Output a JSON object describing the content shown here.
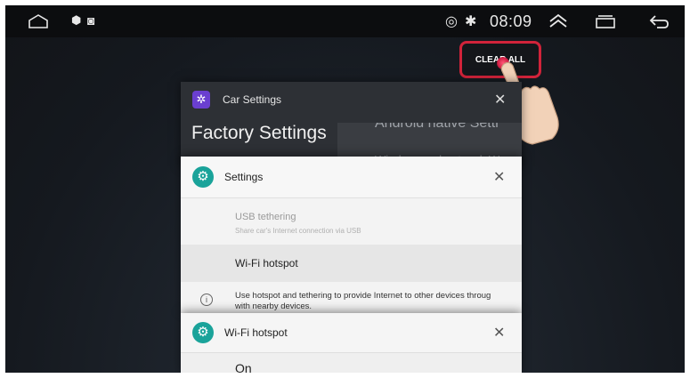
{
  "status_bar": {
    "time": "08:09",
    "icons": [
      "home-icon",
      "location-icon",
      "screenshot-icon",
      "hotspot-icon",
      "bluetooth-icon",
      "expand-up-icon",
      "recent-apps-icon",
      "back-icon"
    ]
  },
  "recents": {
    "clear_all_label": "CLEAR ALL"
  },
  "cards": [
    {
      "app_title": "Car Settings",
      "heading": "Factory Settings",
      "preview_line1": "Android native Setti",
      "preview_line2": "Wireless and network:W"
    },
    {
      "app_title": "Settings",
      "usb_title": "USB tethering",
      "usb_subtitle": "Share car's Internet connection via USB",
      "hotspot_label": "Wi-Fi hotspot",
      "info_text_line1": "Use hotspot and tethering to provide Internet to other devices throug",
      "info_text_line2": "with nearby devices."
    },
    {
      "app_title": "Wi-Fi hotspot",
      "state_label": "On"
    }
  ],
  "colors": {
    "accent_red": "#d1233a",
    "settings_teal": "#1aa39a",
    "car_settings_purple": "#6a3fd0"
  }
}
